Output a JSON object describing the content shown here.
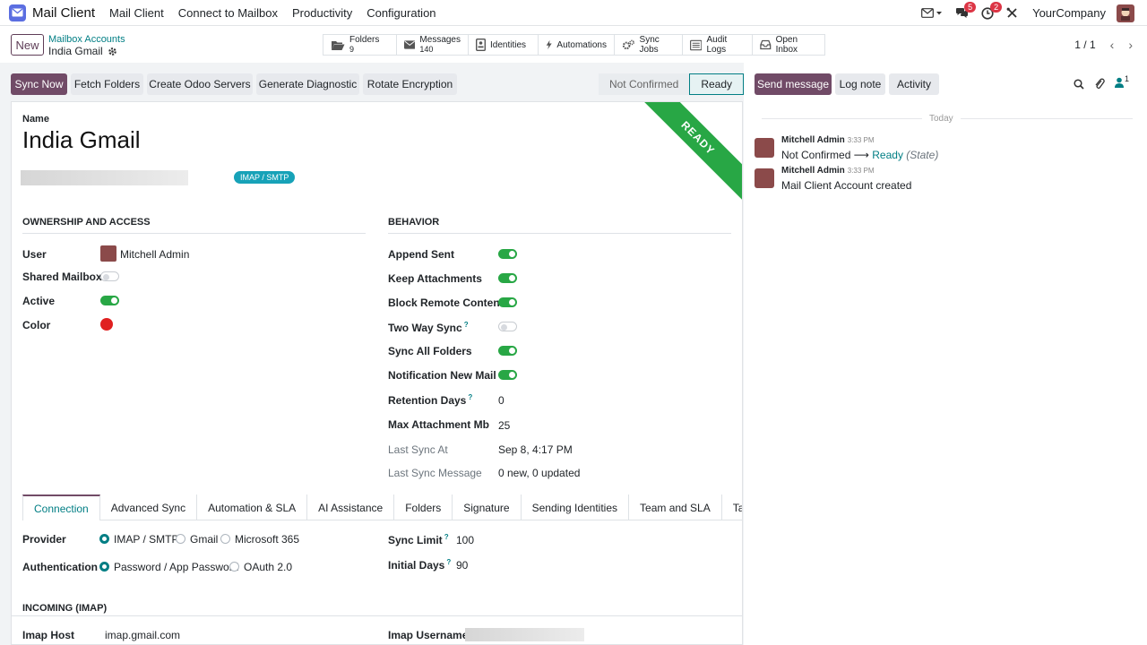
{
  "navbar": {
    "app_name": "Mail Client",
    "menu": [
      "Mail Client",
      "Connect to Mailbox",
      "Productivity",
      "Configuration"
    ],
    "messages_badge": "5",
    "activity_badge": "2",
    "company": "YourCompany"
  },
  "control": {
    "new_label": "New",
    "breadcrumb_parent": "Mailbox Accounts",
    "breadcrumb_current": "India Gmail",
    "smart_buttons": {
      "folders_label": "Folders",
      "folders_count": "9",
      "messages_label": "Messages",
      "messages_count": "140",
      "identities": "Identities",
      "automations": "Automations",
      "sync_jobs": "Sync Jobs",
      "audit_logs": "Audit Logs",
      "open_inbox": "Open Inbox"
    },
    "pager": "1 / 1"
  },
  "header": {
    "sync_now": "Sync Now",
    "fetch_folders": "Fetch Folders",
    "create_servers": "Create Odoo Servers",
    "generate_diagnostic": "Generate Diagnostic",
    "rotate_encryption": "Rotate Encryption",
    "stages": [
      "Not Confirmed",
      "Ready"
    ],
    "active_stage": "Ready"
  },
  "form": {
    "ribbon": "READY",
    "name_label": "Name",
    "name_value": "India Gmail",
    "tag": "IMAP / SMTP",
    "ownership": {
      "title": "OWNERSHIP AND ACCESS",
      "user_label": "User",
      "user_value": "Mitchell Admin",
      "shared_label": "Shared Mailbox",
      "shared_on": false,
      "active_label": "Active",
      "active_on": true,
      "color_label": "Color",
      "color_value": "#e02020"
    },
    "behavior": {
      "title": "BEHAVIOR",
      "append_sent": "Append Sent",
      "keep_attachments": "Keep Attachments",
      "block_remote": "Block Remote Content",
      "two_way_sync": "Two Way Sync",
      "sync_all_folders": "Sync All Folders",
      "notification_new_mail": "Notification New Mail",
      "retention_days_label": "Retention Days",
      "retention_days": "0",
      "max_attachment_label": "Max Attachment Mb",
      "max_attachment": "25",
      "last_sync_at_label": "Last Sync At",
      "last_sync_at": "Sep 8, 4:17 PM",
      "last_sync_msg_label": "Last Sync Message",
      "last_sync_msg": "0 new, 0 updated",
      "help_mark": "?"
    },
    "tabs": [
      "Connection",
      "Advanced Sync",
      "Automation & SLA",
      "AI Assistance",
      "Folders",
      "Signature",
      "Sending Identities",
      "Team and SLA",
      "Taxonomy and AI"
    ],
    "connection": {
      "provider_label": "Provider",
      "provider_options": [
        "IMAP / SMTP",
        "Gmail",
        "Microsoft 365"
      ],
      "auth_label": "Authentication",
      "auth_options": [
        "Password / App Password",
        "OAuth 2.0"
      ],
      "sync_limit_label": "Sync Limit",
      "sync_limit": "100",
      "initial_days_label": "Initial Days",
      "initial_days": "90"
    },
    "incoming": {
      "title": "INCOMING (IMAP)",
      "imap_host_label": "Imap Host",
      "imap_host": "imap.gmail.com",
      "imap_username_label": "Imap Username"
    }
  },
  "chatter": {
    "send_message": "Send message",
    "log_note": "Log note",
    "activity": "Activity",
    "followers_count": "1",
    "today": "Today",
    "messages": [
      {
        "author": "Mitchell Admin",
        "time": "3:33 PM",
        "old": "Not Confirmed",
        "arrow": "⟶",
        "new": "Ready",
        "field": "(State)"
      },
      {
        "author": "Mitchell Admin",
        "time": "3:33 PM",
        "body": "Mail Client Account created"
      }
    ]
  },
  "colors": {
    "primary": "#714b67",
    "accent": "#017e84",
    "success": "#28a745",
    "danger": "#dc3545"
  }
}
